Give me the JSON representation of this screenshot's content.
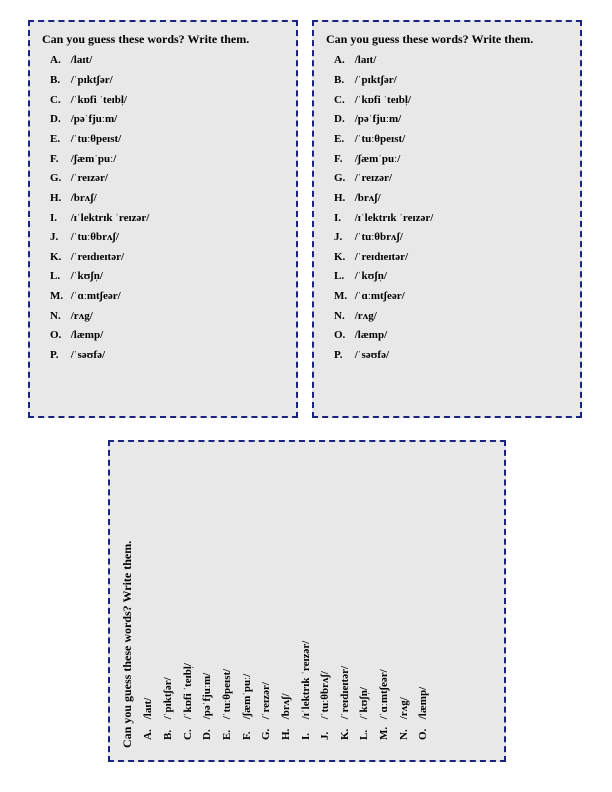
{
  "title": "Can you guess these words? Write them.",
  "words": [
    {
      "label": "A.",
      "ipa": "/laɪt/"
    },
    {
      "label": "B.",
      "ipa": "/ˈpɪktʃər/"
    },
    {
      "label": "C.",
      "ipa": "/ˈkɒfi ˈteɪbl̩/"
    },
    {
      "label": "D.",
      "ipa": "/pəˈfjuːm/"
    },
    {
      "label": "E.",
      "ipa": "/ˈtuːθpeɪst/"
    },
    {
      "label": "F.",
      "ipa": "/ʃæmˈpuː/"
    },
    {
      "label": "G.",
      "ipa": "/ˈreɪzər/"
    },
    {
      "label": "H.",
      "ipa": "/brʌʃ/"
    },
    {
      "label": "I.",
      "ipa": "/ɪˈlektrɪk ˈreɪzər/"
    },
    {
      "label": "J.",
      "ipa": "/ˈtuːθbrʌʃ/"
    },
    {
      "label": "K.",
      "ipa": "/ˈreɪdɪeɪtər/"
    },
    {
      "label": "L.",
      "ipa": "/ˈkʊʃn̩/"
    },
    {
      "label": "M.",
      "ipa": "/ˈɑːmtʃeər/"
    },
    {
      "label": "N.",
      "ipa": "/rʌg/"
    },
    {
      "label": "O.",
      "ipa": "/læmp/"
    },
    {
      "label": "P.",
      "ipa": "/ˈsəʊfə/"
    }
  ],
  "bottom_count": 15
}
